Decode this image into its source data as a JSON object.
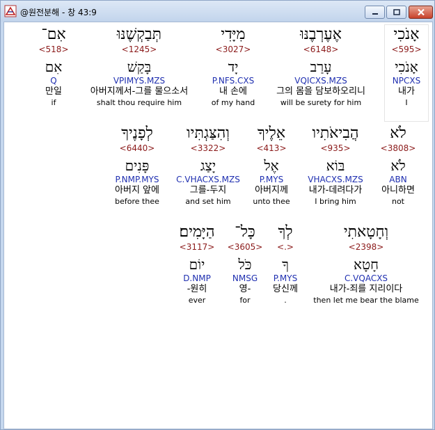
{
  "window": {
    "title": "@원전분해 - 창 43:9"
  },
  "rows": [
    {
      "words": [
        {
          "heb": "אָנֹכִי",
          "strong": "<595>",
          "lemma": "אָנֹכִי",
          "parse": "NPCXS",
          "kor": "내가",
          "eng": "I",
          "highlight": true
        },
        {
          "heb": "אֶעֶרְבֶנּוּ",
          "strong": "<6148>",
          "lemma": "עָרַב",
          "parse": "VQICXS.MZS",
          "kor": "그의 몸을 담보하오리니",
          "eng": "will be surety for him"
        },
        {
          "heb": "מִיָּדִי",
          "strong": "<3027>",
          "lemma": "יָד",
          "parse": "P.NFS.CXS",
          "kor": "내 손에",
          "eng": "of my hand"
        },
        {
          "heb": "תְּבַקְשֶׁנּוּ",
          "strong": "<1245>",
          "lemma": "בָּקַשׁ",
          "parse": "VPIMYS.MZS",
          "kor": "아버지께서-그를 물으소서",
          "eng": "shalt thou require him"
        },
        {
          "heb": "אִם־",
          "strong": "<518>",
          "lemma": "אִם",
          "parse": "Q",
          "kor": "만일",
          "eng": "if"
        }
      ]
    },
    {
      "words": [
        {
          "heb": "לֹא",
          "strong": "<3808>",
          "lemma": "לֹא",
          "parse": "ABN",
          "kor": "아니하면",
          "eng": "not"
        },
        {
          "heb": "הֲבִיאֹתִיו",
          "strong": "<935>",
          "lemma": "בּוֹא",
          "parse": "VHACXS.MZS",
          "kor": "내가-데려다가",
          "eng": "I bring him"
        },
        {
          "heb": "אֵלֶיךָ",
          "strong": "<413>",
          "lemma": "אֶל",
          "parse": "P.MYS",
          "kor": "아버지께",
          "eng": "unto thee"
        },
        {
          "heb": "וְהִצַּגְתִּיו",
          "strong": "<3322>",
          "lemma": "יָצַג",
          "parse": "C.VHACXS.MZS",
          "kor": "그를-두지",
          "eng": "and set him"
        },
        {
          "heb": "לְפָנֶיךָ",
          "strong": "<6440>",
          "lemma": "פָּנִים",
          "parse": "P.NMP.MYS",
          "kor": "아버지 앞에",
          "eng": "before thee"
        }
      ]
    },
    {
      "words": [
        {
          "heb": "וְחָטָאתִי",
          "strong": "<2398>",
          "lemma": "חָטָא",
          "parse": "C.VQACXS",
          "kor": "내가-죄를 지리이다",
          "eng": "then let me bear the blame"
        },
        {
          "heb": "לְךָ",
          "strong": "<.>",
          "lemma": "ךָ",
          "parse": "P.MYS",
          "kor": "당신께",
          "eng": "."
        },
        {
          "heb": "כָּל־",
          "strong": "<3605>",
          "lemma": "כֹּל",
          "parse": "NMSG",
          "kor": "영-",
          "eng": "for"
        },
        {
          "heb": "הַיָּמִים׃",
          "strong": "<3117>",
          "lemma": "יוֹם",
          "parse": "D.NMP",
          "kor": "-원히",
          "eng": "ever"
        }
      ]
    }
  ]
}
